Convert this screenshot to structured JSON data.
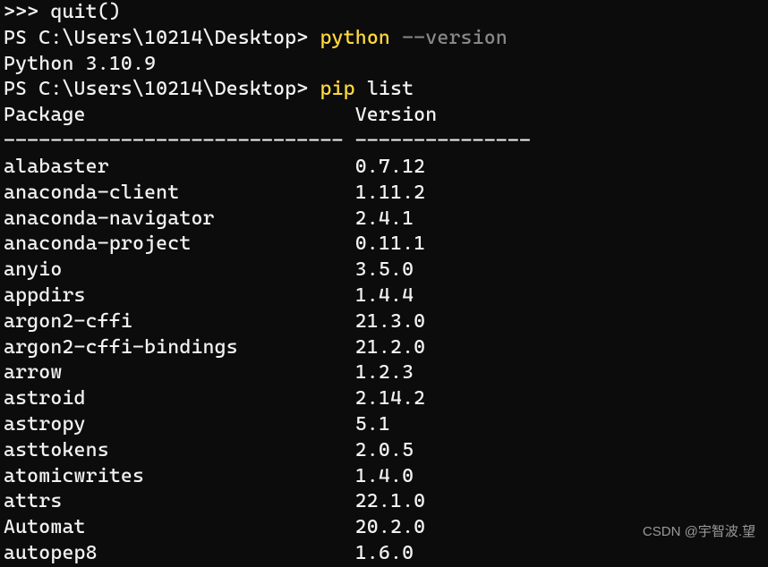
{
  "lines": {
    "quit_line": ">>> quit()",
    "prompt1_prefix": "PS C:\\Users\\10214\\Desktop> ",
    "cmd_python": "python",
    "cmd_version_flag": " --version",
    "python_version_output": "Python 3.10.9",
    "prompt2_prefix": "PS C:\\Users\\10214\\Desktop> ",
    "cmd_pip": "pip",
    "cmd_list": " list"
  },
  "pip_header": {
    "col1": "Package",
    "col2": "Version",
    "divider1": "-----------------------------",
    "divider2": "---------------"
  },
  "packages": [
    {
      "name": "alabaster",
      "version": "0.7.12"
    },
    {
      "name": "anaconda-client",
      "version": "1.11.2"
    },
    {
      "name": "anaconda-navigator",
      "version": "2.4.1"
    },
    {
      "name": "anaconda-project",
      "version": "0.11.1"
    },
    {
      "name": "anyio",
      "version": "3.5.0"
    },
    {
      "name": "appdirs",
      "version": "1.4.4"
    },
    {
      "name": "argon2-cffi",
      "version": "21.3.0"
    },
    {
      "name": "argon2-cffi-bindings",
      "version": "21.2.0"
    },
    {
      "name": "arrow",
      "version": "1.2.3"
    },
    {
      "name": "astroid",
      "version": "2.14.2"
    },
    {
      "name": "astropy",
      "version": "5.1"
    },
    {
      "name": "asttokens",
      "version": "2.0.5"
    },
    {
      "name": "atomicwrites",
      "version": "1.4.0"
    },
    {
      "name": "attrs",
      "version": "22.1.0"
    },
    {
      "name": "Automat",
      "version": "20.2.0"
    },
    {
      "name": "autopep8",
      "version": "1.6.0"
    }
  ],
  "watermark": "CSDN @宇智波.望"
}
